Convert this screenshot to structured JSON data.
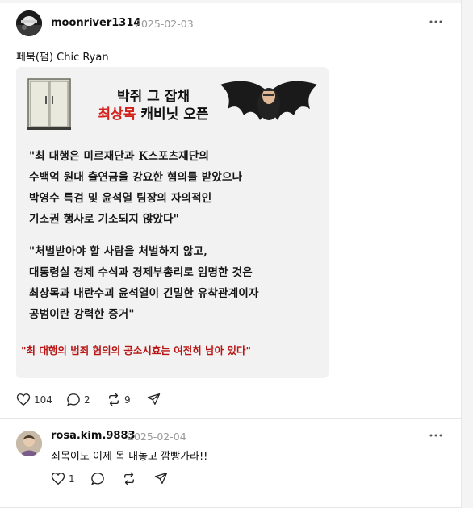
{
  "post": {
    "username": "moonriver1314",
    "timestamp": "2025-02-03",
    "text": "페북(펌) Chic Ryan",
    "image": {
      "headline_line1": "박쥐 그 잡채",
      "headline_name": "최상목",
      "headline_rest": " 캐비닛 오픈",
      "quote1": [
        "\"최 대행은 미르재단과 K스포츠재단의",
        "수백억 원대 출연금을 강요한 혐의를 받았으나",
        "박영수 특검 및 윤석열 팀장의 자의적인",
        "기소권 행사로 기소되지 않았다\""
      ],
      "quote2": [
        "\"처벌받아야 할 사람을 처벌하지 않고,",
        "대통령실 경제 수석과 경제부총리로 임명한 것은",
        "최상목과 내란수괴 윤석열이 긴밀한 유착관계이자",
        "공범이란 강력한 증거\""
      ],
      "closing": "\"최 대행의 범죄 혐의의 공소시효는 여전히 남아 있다\"",
      "accent_color": "#d4201a"
    },
    "actions": {
      "likes": "104",
      "replies": "2",
      "reposts": "9"
    }
  },
  "reply": {
    "username": "rosa.kim.9883",
    "timestamp": "2025-02-04",
    "text": "죄목이도 이제 목 내놓고 깜빵가라!!",
    "actions": {
      "likes": "1"
    }
  }
}
